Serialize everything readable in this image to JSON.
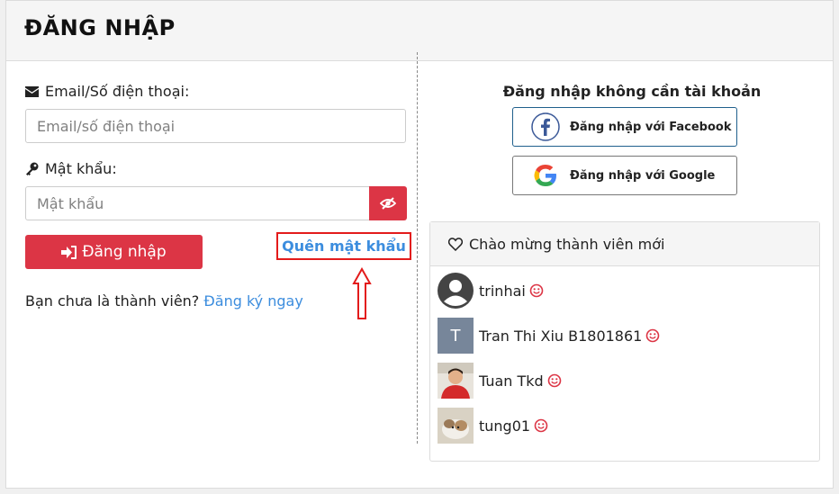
{
  "header": {
    "title": "ĐĂNG NHẬP"
  },
  "form": {
    "email_label": "Email/Số điện thoại:",
    "email_placeholder": "Email/số điện thoại",
    "email_value": "",
    "password_label": "Mật khẩu:",
    "password_placeholder": "Mật khẩu",
    "password_value": "",
    "login_button": "Đăng nhập",
    "forgot_link": "Quên mật khẩu",
    "signup_prompt": "Bạn chưa là thành viên?",
    "signup_link": "Đăng ký ngay"
  },
  "social": {
    "title": "Đăng nhập không cần tài khoản",
    "facebook_label": "Đăng nhập với Facebook",
    "google_label": "Đăng nhập với Google"
  },
  "members": {
    "title": "Chào mừng thành viên mới",
    "items": [
      {
        "name": "trinhai",
        "avatar": "default-user-icon"
      },
      {
        "name": "Tran Thi Xiu B1801861",
        "avatar": "letter-avatar",
        "initial": "T"
      },
      {
        "name": "Tuan Tkd",
        "avatar": "photo-avatar"
      },
      {
        "name": "tung01",
        "avatar": "photo-avatar"
      }
    ]
  },
  "colors": {
    "primary_red": "#dc3545",
    "link_blue": "#3c8dde",
    "highlight_red": "#e31b1b",
    "facebook_blue": "#1f5f8c"
  }
}
